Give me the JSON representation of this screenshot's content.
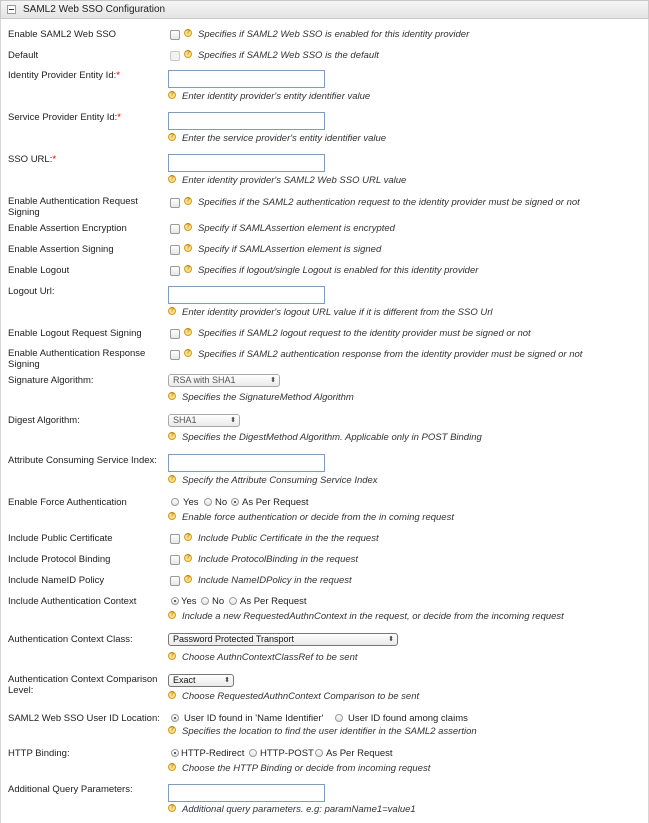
{
  "header": {
    "title": "SAML2 Web SSO Configuration"
  },
  "hint_icon_glyph": "?",
  "rows": {
    "enable_saml": {
      "label": "Enable SAML2 Web SSO",
      "hint": "Specifies if SAML2 Web SSO is enabled for this identity provider"
    },
    "default": {
      "label": "Default",
      "hint": "Specifies if SAML2 Web SSO is the default"
    },
    "idp_entity": {
      "label": "Identity Provider Entity Id:",
      "req": "*",
      "hint": "Enter identity provider's entity identifier value"
    },
    "sp_entity": {
      "label": "Service Provider Entity Id:",
      "req": "*",
      "hint": "Enter the service provider's entity identifier value"
    },
    "sso_url": {
      "label": "SSO URL:",
      "req": "*",
      "hint": "Enter identity provider's SAML2 Web SSO URL value"
    },
    "authn_req_sign": {
      "label": "Enable Authentication Request Signing",
      "hint": "Specifies if the SAML2 authentication request to the identity provider must be signed or not"
    },
    "assert_enc": {
      "label": "Enable Assertion Encryption",
      "hint": "Specify if SAMLAssertion element is encrypted"
    },
    "assert_sign": {
      "label": "Enable Assertion Signing",
      "hint": "Specify if SAMLAssertion element is signed"
    },
    "logout": {
      "label": "Enable Logout",
      "hint": "Specifies if logout/single Logout is enabled for this identity provider"
    },
    "logout_url": {
      "label": "Logout Url:",
      "hint": "Enter identity provider's logout URL value if it is different from the SSO Url"
    },
    "logout_req_sign": {
      "label": "Enable Logout Request Signing",
      "hint": "Specifies if SAML2 logout request to the identity provider must be signed or not"
    },
    "authn_resp_sign": {
      "label": "Enable Authentication Response Signing",
      "hint": "Specifies if SAML2 authentication response from the identity provider must be signed or not"
    },
    "sig_alg": {
      "label": "Signature Algorithm:",
      "value": "RSA with SHA1",
      "hint": "Specifies the SignatureMethod Algorithm"
    },
    "digest_alg": {
      "label": "Digest Algorithm:",
      "value": "SHA1",
      "hint": "Specifies the DigestMethod Algorithm. Applicable only in POST Binding"
    },
    "acs_index": {
      "label": "Attribute Consuming Service Index:",
      "hint": "Specify the Attribute Consuming Service Index"
    },
    "force_auth": {
      "label": "Enable Force Authentication",
      "options": [
        "Yes",
        "No",
        "As Per Request"
      ],
      "hint": "Enable force authentication or decide from the in coming request"
    },
    "pub_cert": {
      "label": "Include Public Certificate",
      "hint": "Include Public Certificate in the the request"
    },
    "proto_bind": {
      "label": "Include Protocol Binding",
      "hint": "Include ProtocolBinding in the request"
    },
    "nameid": {
      "label": "Include NameID Policy",
      "hint": "Include NameIDPolicy in the request"
    },
    "auth_ctx": {
      "label": "Include Authentication Context",
      "options": [
        "Yes",
        "No",
        "As Per Request"
      ],
      "hint": "Include a new RequestedAuthnContext in the request, or decide from the incoming request"
    },
    "auth_ctx_class": {
      "label": "Authentication Context Class:",
      "value": "Password Protected Transport",
      "hint": "Choose AuthnContextClassRef to be sent"
    },
    "auth_ctx_cmp": {
      "label": "Authentication Context Comparison Level:",
      "value": "Exact",
      "hint": "Choose RequestedAuthnContext Comparison to be sent"
    },
    "user_id_loc": {
      "label": "SAML2 Web SSO User ID Location:",
      "options": [
        "User ID found in 'Name Identifier'",
        "User ID found among claims"
      ],
      "hint": "Specifies the location to find the user identifier in the SAML2 assertion"
    },
    "http_binding": {
      "label": "HTTP Binding:",
      "options": [
        "HTTP-Redirect",
        "HTTP-POST",
        "As Per Request"
      ],
      "hint": "Choose the HTTP Binding or decide from incoming request"
    },
    "query_params": {
      "label": "Additional Query Parameters:",
      "hint": "Additional query parameters. e.g: paramName1=value1"
    }
  }
}
